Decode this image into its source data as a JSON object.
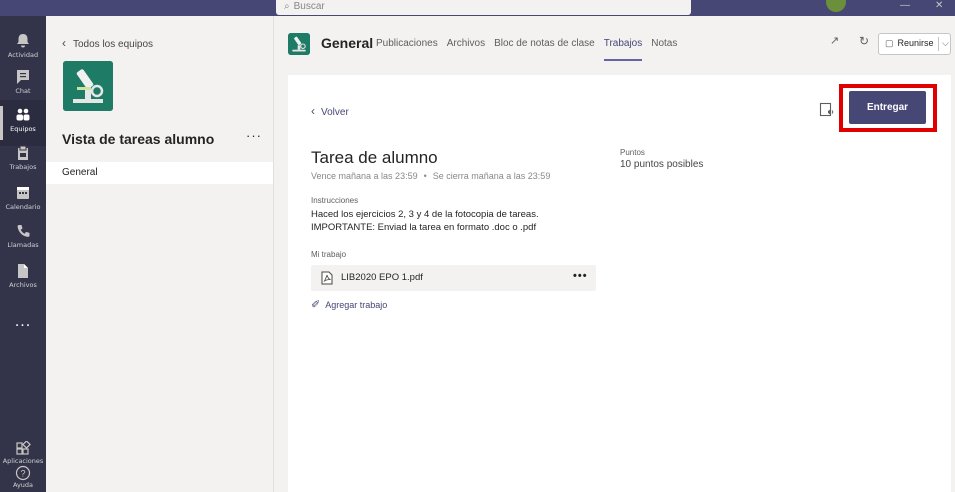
{
  "search": {
    "placeholder": "Buscar"
  },
  "rail": {
    "items": [
      {
        "label": "Actividad",
        "icon": "bell-icon"
      },
      {
        "label": "Chat",
        "icon": "chat-icon"
      },
      {
        "label": "Equipos",
        "icon": "teams-icon"
      },
      {
        "label": "Trabajos",
        "icon": "assignments-icon"
      },
      {
        "label": "Calendario",
        "icon": "calendar-icon"
      },
      {
        "label": "Llamadas",
        "icon": "phone-icon"
      },
      {
        "label": "Archivos",
        "icon": "files-icon"
      }
    ],
    "more": "...",
    "apps_label": "Aplicaciones",
    "help_label": "Ayuda"
  },
  "leftpanel": {
    "back_label": "Todos los equipos",
    "team_name": "Vista de tareas alumno",
    "team_more": "···",
    "channel": "General"
  },
  "header": {
    "channel_name": "General",
    "tabs": [
      {
        "label": "Publicaciones"
      },
      {
        "label": "Archivos"
      },
      {
        "label": "Bloc de notas de clase"
      },
      {
        "label": "Trabajos"
      },
      {
        "label": "Notas"
      }
    ],
    "active_tab": "Trabajos",
    "meet_label": "Reunirse"
  },
  "assignment": {
    "back_label": "Volver",
    "submit_label": "Entregar",
    "title": "Tarea de alumno",
    "due": "Vence mañana a las 23:59",
    "due_sep": "•",
    "closes": "Se cierra mañana a las 23:59",
    "points_label": "Puntos",
    "points_value": "10 puntos posibles",
    "instructions_label": "Instrucciones",
    "instructions_line1": "Haced los ejercicios 2, 3 y 4 de la fotocopia de tareas.",
    "instructions_line2": "IMPORTANTE: Enviad la tarea en formato .doc o .pdf",
    "my_work_label": "Mi trabajo",
    "file_name": "LIB2020 EPO 1.pdf",
    "file_more": "•••",
    "add_work_label": "Agregar trabajo"
  },
  "colors": {
    "brand": "#464775",
    "rail": "#33344a",
    "highlight": "#e00000"
  }
}
